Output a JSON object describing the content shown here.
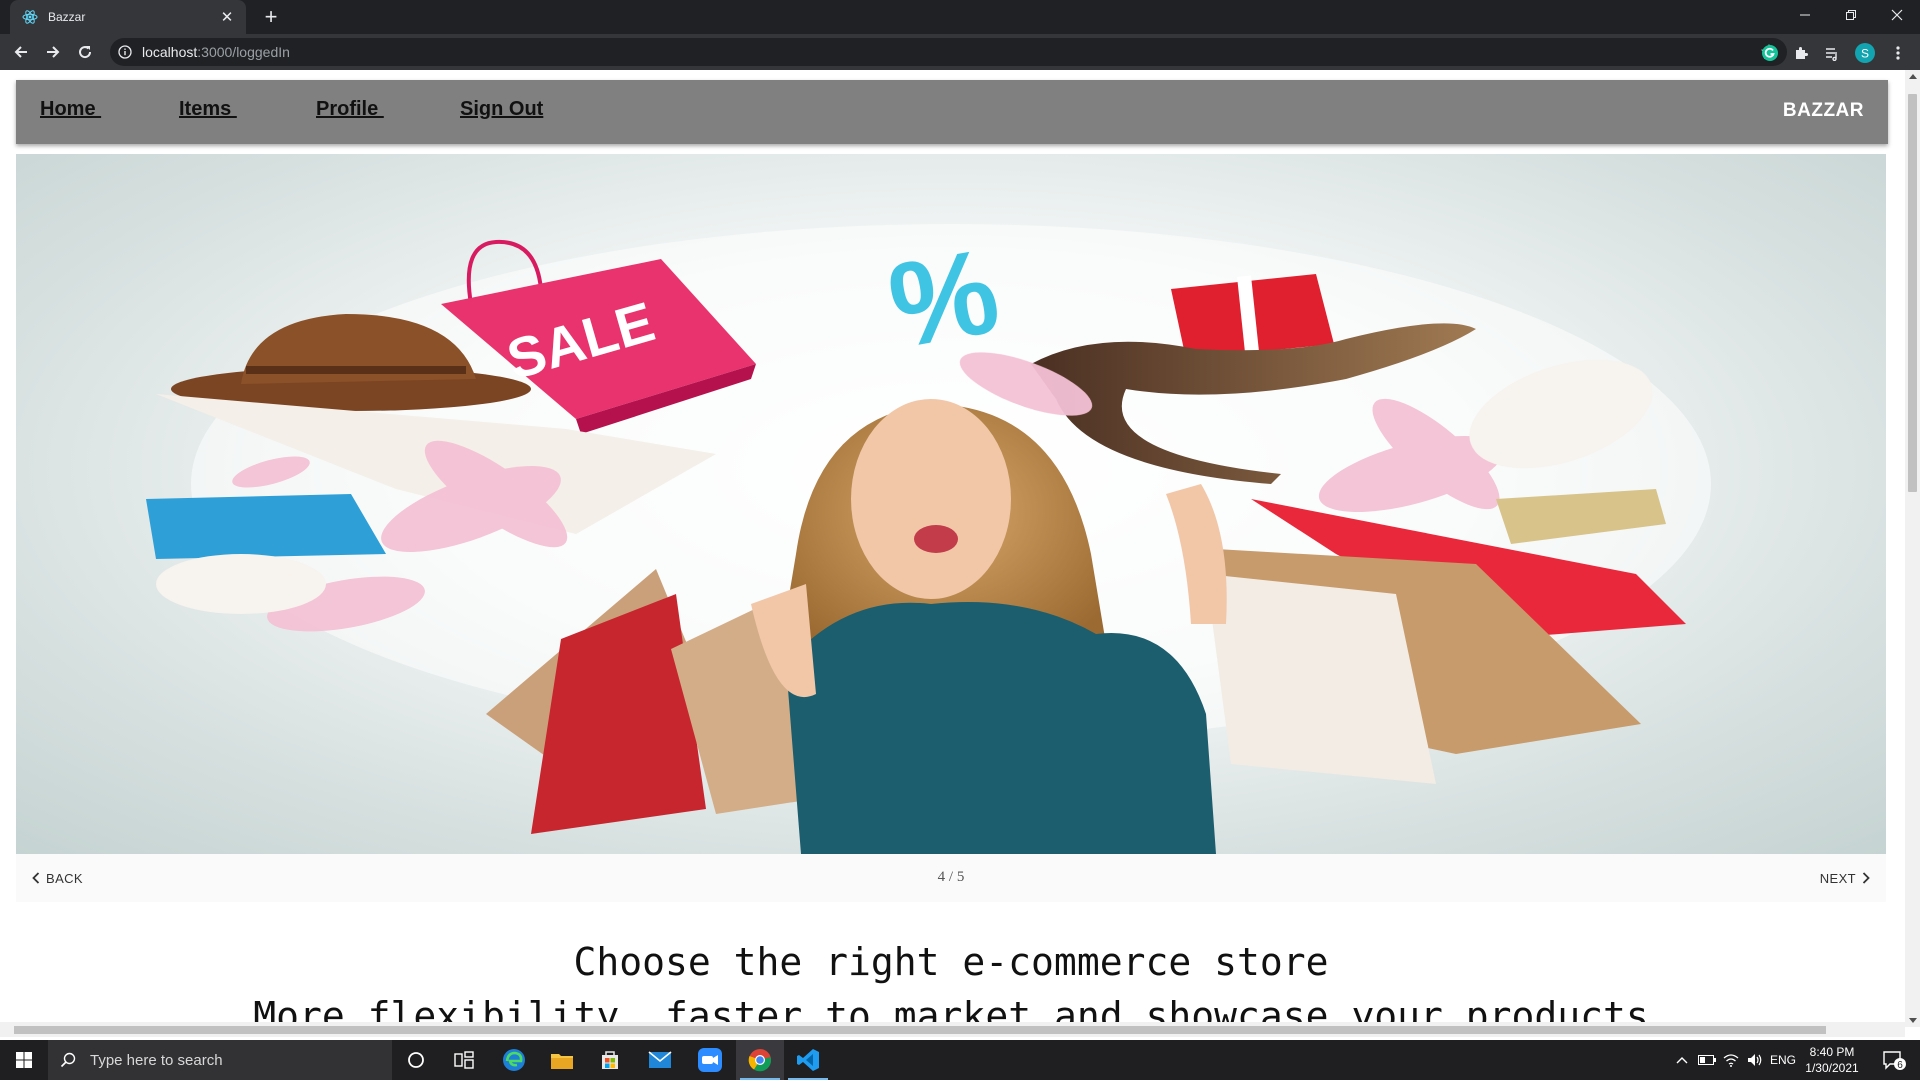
{
  "browser": {
    "tab_title": "Bazzar",
    "tab_close": "✕",
    "new_tab": "+",
    "url_host": "localhost",
    "url_path": ":3000/loggedIn",
    "profile_initial": "S"
  },
  "navbar": {
    "links": [
      "Home ",
      "Items ",
      "Profile ",
      "Sign Out"
    ],
    "brand": "BAZZAR",
    "bg_color": "#808080"
  },
  "carousel": {
    "image_description": "",
    "sale_text": "SALE",
    "percent_text": "%",
    "back_label": "BACK",
    "next_label": "NEXT",
    "counter": "4 / 5"
  },
  "content": {
    "headline": "Choose the right e-commerce store",
    "subline": "More flexibility, faster to market and showcase your products"
  },
  "taskbar": {
    "search_placeholder": "Type here to search",
    "language": "ENG",
    "time": "8:40 PM",
    "date": "1/30/2021",
    "notifications": "6",
    "accent_color": "#76b9ed"
  }
}
